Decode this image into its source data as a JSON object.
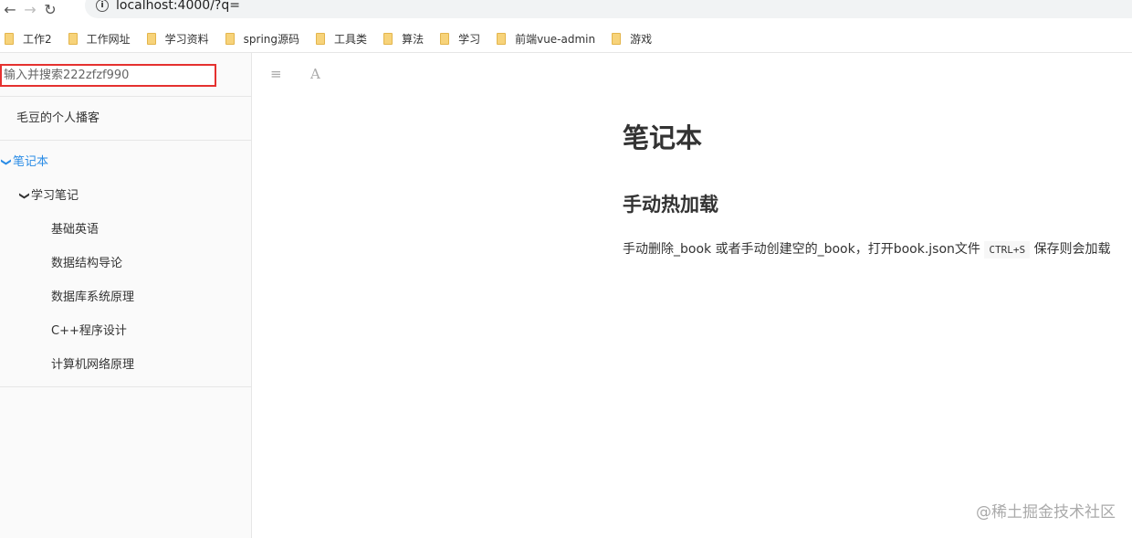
{
  "browser": {
    "url": "localhost:4000/?q=",
    "bookmarks": [
      "工作2",
      "工作网址",
      "学习资料",
      "spring源码",
      "工具类",
      "算法",
      "学习",
      "前端vue-admin",
      "游戏"
    ]
  },
  "sidebar": {
    "search_value": "输入并搜索222zfzf990",
    "blog_title": "毛豆的个人播客",
    "section": "笔记本",
    "group": "学习笔记",
    "items": [
      "基础英语",
      "数据结构导论",
      "数据库系统原理",
      "C++程序设计",
      "计算机网络原理"
    ]
  },
  "toolbar": {
    "menu_icon": "≡",
    "font_icon": "A"
  },
  "content": {
    "title": "笔记本",
    "heading": "手动热加载",
    "text_before": "手动删除_book 或者手动创建空的_book，打开book.json文件",
    "code": "CTRL+S",
    "text_after": "保存则会加载"
  },
  "watermark": "@稀土掘金技术社区",
  "colors": {
    "accent": "#2a8ce6",
    "search_border": "#e5312f"
  }
}
